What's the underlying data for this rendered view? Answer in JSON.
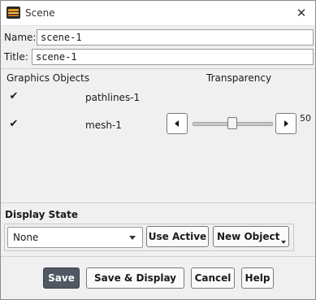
{
  "window": {
    "title": "Scene",
    "icon": "app-logo-icon",
    "close_icon": "close-icon",
    "close_glyph": "✕"
  },
  "form": {
    "name_label": "Name:",
    "name_value": "scene-1",
    "title_label": "Title:",
    "title_value": "scene-1"
  },
  "graphics": {
    "header_objects": "Graphics Objects",
    "header_transparency": "Transparency",
    "items": [
      {
        "label": "pathlines-1",
        "checked": true,
        "check_glyph": "✔"
      },
      {
        "label": "mesh-1",
        "checked": true,
        "check_glyph": "✔"
      }
    ],
    "transparency_value": "50",
    "transparency_fraction": 0.5
  },
  "display_state": {
    "label": "Display State",
    "selected": "None",
    "use_active_label": "Use Active",
    "new_object_label": "New Object"
  },
  "footer": {
    "save_label": "Save",
    "save_display_label": "Save & Display",
    "cancel_label": "Cancel",
    "help_label": "Help"
  },
  "colors": {
    "primary_button_bg": "#4f5863",
    "window_bg": "#f0f0f0",
    "logo_orange": "#e89a1c"
  }
}
